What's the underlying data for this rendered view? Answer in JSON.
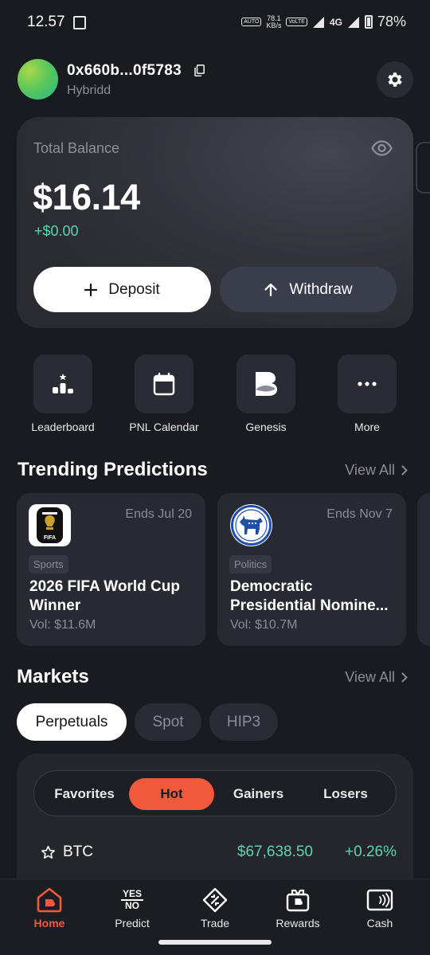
{
  "status_bar": {
    "time": "12.57",
    "speed_value": "78.1",
    "speed_unit": "KB/s",
    "auto_label": "AUTO",
    "volte_label": "VoLTE",
    "network": "4G",
    "battery": "78%"
  },
  "header": {
    "wallet_address": "0x660b...0f5783",
    "wallet_name": "Hybridd"
  },
  "balance": {
    "label": "Total Balance",
    "value": "$16.14",
    "change": "+$0.00",
    "deposit_label": "Deposit",
    "withdraw_label": "Withdraw"
  },
  "quick_actions": [
    {
      "label": "Leaderboard",
      "icon": "podium-icon"
    },
    {
      "label": "PNL Calendar",
      "icon": "calendar-icon"
    },
    {
      "label": "Genesis",
      "icon": "genesis-logo-icon"
    },
    {
      "label": "More",
      "icon": "more-dots-icon"
    }
  ],
  "trending": {
    "title": "Trending Predictions",
    "view_all": "View All",
    "cards": [
      {
        "ends": "Ends Jul 20",
        "tag": "Sports",
        "title_line1": "2026 FIFA World Cup",
        "title_line2": "Winner",
        "volume": "Vol: $11.6M",
        "logo_text": "FIFA"
      },
      {
        "ends": "Ends Nov 7",
        "tag": "Politics",
        "title_line1": "Democratic",
        "title_line2": "Presidential Nomine...",
        "volume": "Vol: $10.7M"
      }
    ]
  },
  "markets": {
    "title": "Markets",
    "view_all": "View All",
    "tabs": [
      "Perpetuals",
      "Spot",
      "HIP3"
    ],
    "active_tab": "Perpetuals",
    "filters": [
      "Favorites",
      "Hot",
      "Gainers",
      "Losers"
    ],
    "active_filter": "Hot",
    "rows": [
      {
        "symbol": "BTC",
        "price": "$67,638.50",
        "change": "+0.26%"
      }
    ]
  },
  "bottom_nav": {
    "items": [
      {
        "label": "Home",
        "icon": "home-icon"
      },
      {
        "label": "Predict",
        "icon": "yes-no-icon",
        "icon_top": "YES",
        "icon_bottom": "NO"
      },
      {
        "label": "Trade",
        "icon": "trade-icon"
      },
      {
        "label": "Rewards",
        "icon": "gift-icon"
      },
      {
        "label": "Cash",
        "icon": "contactless-card-icon"
      }
    ],
    "active": "Home"
  },
  "colors": {
    "background": "#1a1b20",
    "accent": "#f05a3a",
    "positive": "#5fd3b0",
    "muted_text": "#8b8d96"
  }
}
